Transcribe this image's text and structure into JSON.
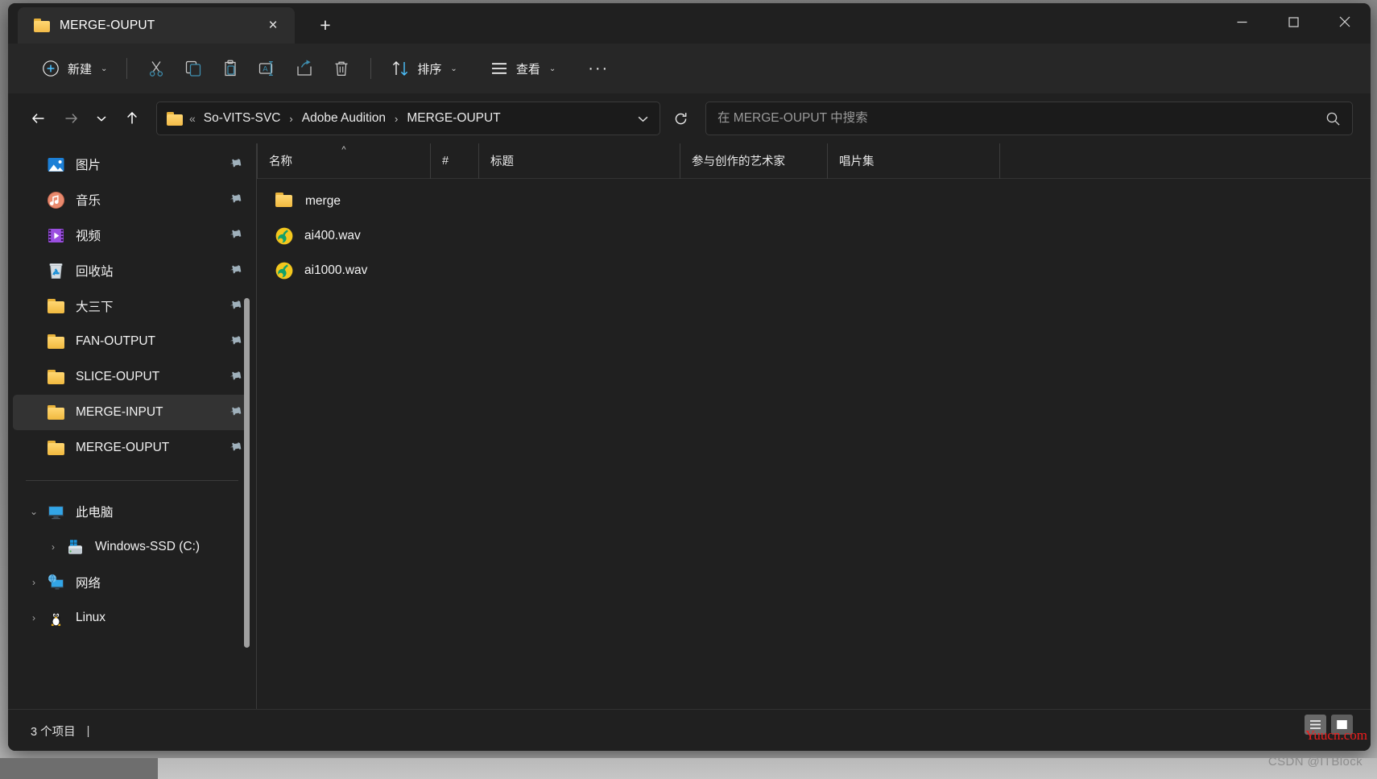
{
  "window": {
    "controls": {
      "minimize": "minimize-button",
      "maximize": "maximize-button",
      "close": "close-button"
    }
  },
  "tabs": {
    "items": [
      {
        "label": "MERGE-OUPUT",
        "icon": "folder-icon",
        "close": "×",
        "active": true
      }
    ],
    "new_tab": "+"
  },
  "toolbar": {
    "new_label": "新建",
    "sort_label": "排序",
    "view_label": "查看",
    "more_label": "···",
    "caret": "⌄",
    "icons": [
      "cut-icon",
      "copy-icon",
      "paste-icon",
      "rename-icon",
      "share-icon",
      "delete-icon"
    ]
  },
  "address": {
    "back": "←",
    "forward": "→",
    "recent_caret": "⌄",
    "up": "↑",
    "ellipsis": "«",
    "crumbs": [
      "So-VITS-SVC",
      "Adobe Audition",
      "MERGE-OUPUT"
    ],
    "separator": "›",
    "dropdown_caret": "⌄",
    "refresh": "refresh-icon"
  },
  "search": {
    "placeholder": "在 MERGE-OUPUT 中搜索",
    "value": ""
  },
  "sidebar": {
    "items": [
      {
        "label": "图片",
        "icon": "pictures-icon",
        "pinned": true,
        "indent": 1,
        "twisty": "",
        "selected": false
      },
      {
        "label": "音乐",
        "icon": "music-icon",
        "pinned": true,
        "indent": 1,
        "twisty": "",
        "selected": false
      },
      {
        "label": "视频",
        "icon": "videos-icon",
        "pinned": true,
        "indent": 1,
        "twisty": "",
        "selected": false
      },
      {
        "label": "回收站",
        "icon": "recycle-bin-icon",
        "pinned": true,
        "indent": 1,
        "twisty": "",
        "selected": false
      },
      {
        "label": "大三下",
        "icon": "folder-icon",
        "pinned": true,
        "indent": 1,
        "twisty": "",
        "selected": false
      },
      {
        "label": "FAN-OUTPUT",
        "icon": "folder-icon",
        "pinned": true,
        "indent": 1,
        "twisty": "",
        "selected": false
      },
      {
        "label": "SLICE-OUPUT",
        "icon": "folder-icon",
        "pinned": true,
        "indent": 1,
        "twisty": "",
        "selected": false
      },
      {
        "label": "MERGE-INPUT",
        "icon": "folder-icon",
        "pinned": true,
        "indent": 1,
        "twisty": "",
        "selected": true
      },
      {
        "label": "MERGE-OUPUT",
        "icon": "folder-icon",
        "pinned": true,
        "indent": 1,
        "twisty": "",
        "selected": false
      }
    ],
    "tree": [
      {
        "label": "此电脑",
        "icon": "this-pc-icon",
        "twisty": "⌄",
        "indent": 0
      },
      {
        "label": "Windows-SSD (C:)",
        "icon": "drive-icon",
        "twisty": "›",
        "indent": 1
      },
      {
        "label": "网络",
        "icon": "network-icon",
        "twisty": "›",
        "indent": 0
      },
      {
        "label": "Linux",
        "icon": "linux-icon",
        "twisty": "›",
        "indent": 0
      }
    ],
    "pin_glyph": "📌"
  },
  "columns": [
    {
      "label": "名称",
      "sorted": "asc",
      "sort_glyph": "^"
    },
    {
      "label": "#",
      "sorted": "",
      "sort_glyph": ""
    },
    {
      "label": "标题",
      "sorted": "",
      "sort_glyph": ""
    },
    {
      "label": "参与创作的艺术家",
      "sorted": "",
      "sort_glyph": ""
    },
    {
      "label": "唱片集",
      "sorted": "",
      "sort_glyph": ""
    }
  ],
  "files": [
    {
      "name": "merge",
      "icon": "folder-icon",
      "num": "",
      "title": "",
      "artists": "",
      "album": ""
    },
    {
      "name": "ai400.wav",
      "icon": "wav-audio-icon",
      "num": "",
      "title": "",
      "artists": "",
      "album": ""
    },
    {
      "name": "ai1000.wav",
      "icon": "wav-audio-icon",
      "num": "",
      "title": "",
      "artists": "",
      "album": ""
    }
  ],
  "status": {
    "item_count": "3 个项目",
    "separator": "|"
  },
  "view_toggles": [
    {
      "name": "details-view-toggle",
      "active": true
    },
    {
      "name": "large-icons-view-toggle",
      "active": false
    }
  ],
  "watermarks": {
    "red": "Yuucn.com",
    "gray": "CSDN @ITBlock"
  },
  "colors": {
    "window_bg": "#202020",
    "toolbar_bg": "#272727",
    "tab_active": "#2d2d2d",
    "selection": "#333333",
    "accent": "#4cc2ff",
    "folder_yellow": "#f3bb48",
    "watermark_red": "#ef1c1c"
  }
}
